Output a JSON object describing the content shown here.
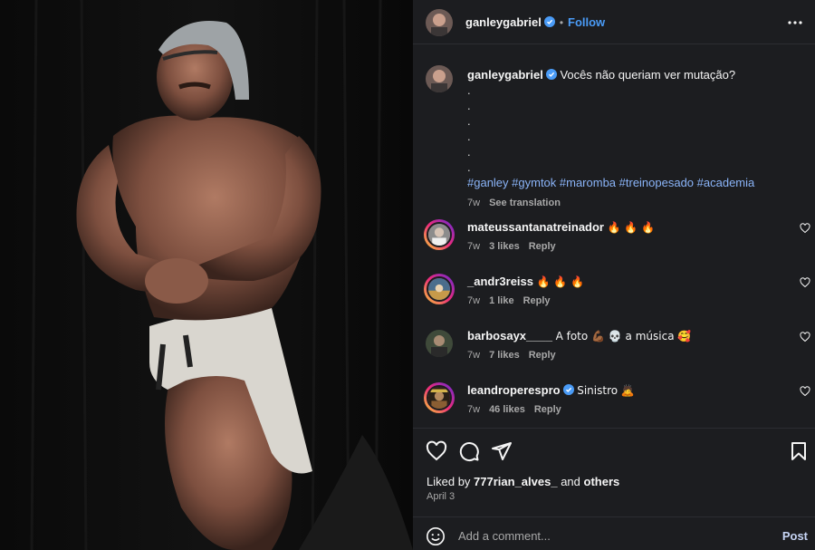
{
  "post": {
    "author": "ganleyGabriel",
    "author_display": "ganleygabriel",
    "follow_label": "Follow",
    "separator": "•",
    "more_icon": "more-horizontal-icon"
  },
  "caption": {
    "author": "ganleygabriel",
    "text": "Vocês não queriam ver mutação?",
    "dots": [
      ".",
      ".",
      ".",
      ".",
      ".",
      "."
    ],
    "hashtags": "#ganley #gymtok #maromba #treinopesado #academia",
    "time": "7w",
    "see_translation": "See translation"
  },
  "comments": [
    {
      "user": "mateussantanatreinador",
      "text": "🔥 🔥 🔥",
      "time": "7w",
      "likes": "3 likes",
      "reply": "Reply"
    },
    {
      "user": "_andr3reiss",
      "text": "🔥 🔥 🔥",
      "time": "7w",
      "likes": "1 like",
      "reply": "Reply"
    },
    {
      "user": "barbosayx____",
      "text": "A foto 💪🏾 💀 a música 🥰",
      "time": "7w",
      "likes": "7 likes",
      "reply": "Reply"
    },
    {
      "user": "leandroperespro",
      "text": "Sinistro 🙇",
      "time": "7w",
      "likes": "46 likes",
      "reply": "Reply"
    }
  ],
  "likes": {
    "prefix": "Liked by",
    "user": "777rian_alves_",
    "and": "and",
    "others": "others"
  },
  "date": "April 3",
  "add_comment": {
    "placeholder": "Add a comment...",
    "post_label": "Post"
  },
  "colors": {
    "panel_bg": "#1c1d20",
    "link_blue": "#4a9bf6",
    "hashtag_blue": "#8ab4f8",
    "muted": "#a8a8a8",
    "story_ring": "#d62976"
  }
}
